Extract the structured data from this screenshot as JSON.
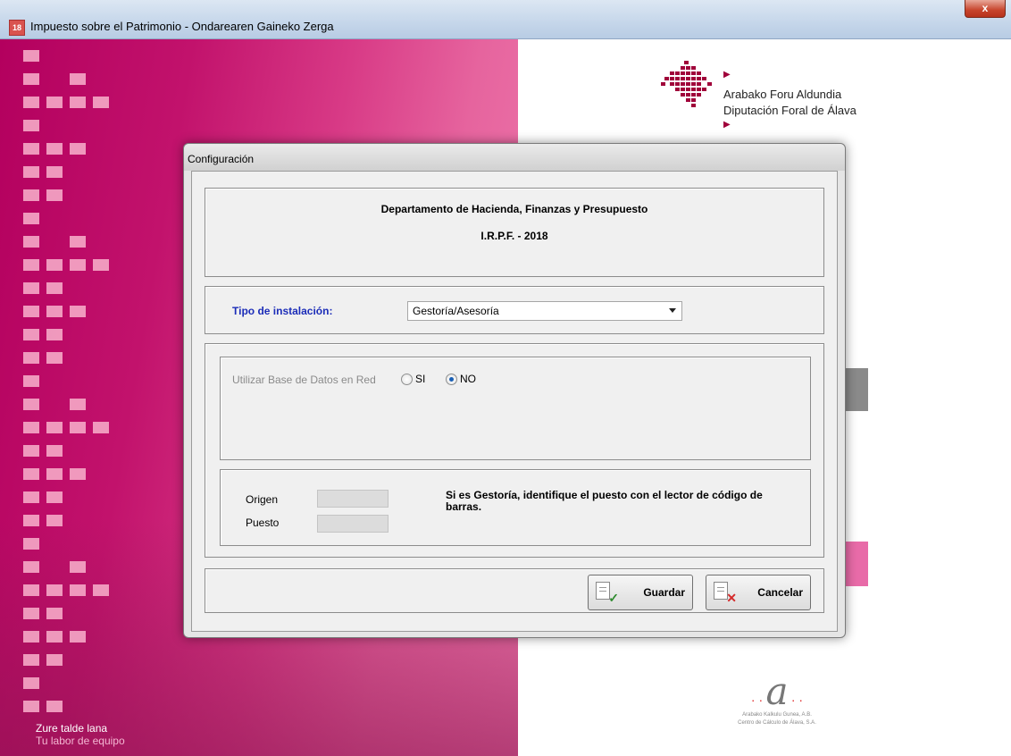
{
  "window": {
    "title": "Impuesto sobre el Patrimonio - Ondarearen Gaineko Zerga",
    "icon_label": "18",
    "close_label": "x"
  },
  "background": {
    "tagline_line1": "Zure talde lana",
    "tagline_line2": "Tu labor de equipo",
    "logo_line1": "Arabako Foru Aldundia",
    "logo_line2": "Diputación Foral de Álava",
    "bottom_logo_line1": "Arabako Kalkulu Gunea, A.B.",
    "bottom_logo_line2": "Centro de Cálculo de Álava, S.A.",
    "colors": {
      "magenta": "#b3005e",
      "pink": "#f07bae"
    }
  },
  "dialog": {
    "title": "Configuración",
    "header": {
      "department": "Departamento de Hacienda, Finanzas y Presupuesto",
      "subtitle": "I.R.P.F. - 2018"
    },
    "install_type": {
      "label": "Tipo de instalación:",
      "selected": "Gestoría/Asesoría"
    },
    "network_db": {
      "label": "Utilizar Base de Datos en Red",
      "options": [
        {
          "label": "SI",
          "selected": false
        },
        {
          "label": "NO",
          "selected": true
        }
      ]
    },
    "barcode": {
      "origen_label": "Origen",
      "puesto_label": "Puesto",
      "message": "Si es Gestoría, identifique el puesto con el lector de código de barras."
    },
    "buttons": {
      "save": "Guardar",
      "cancel": "Cancelar"
    }
  }
}
